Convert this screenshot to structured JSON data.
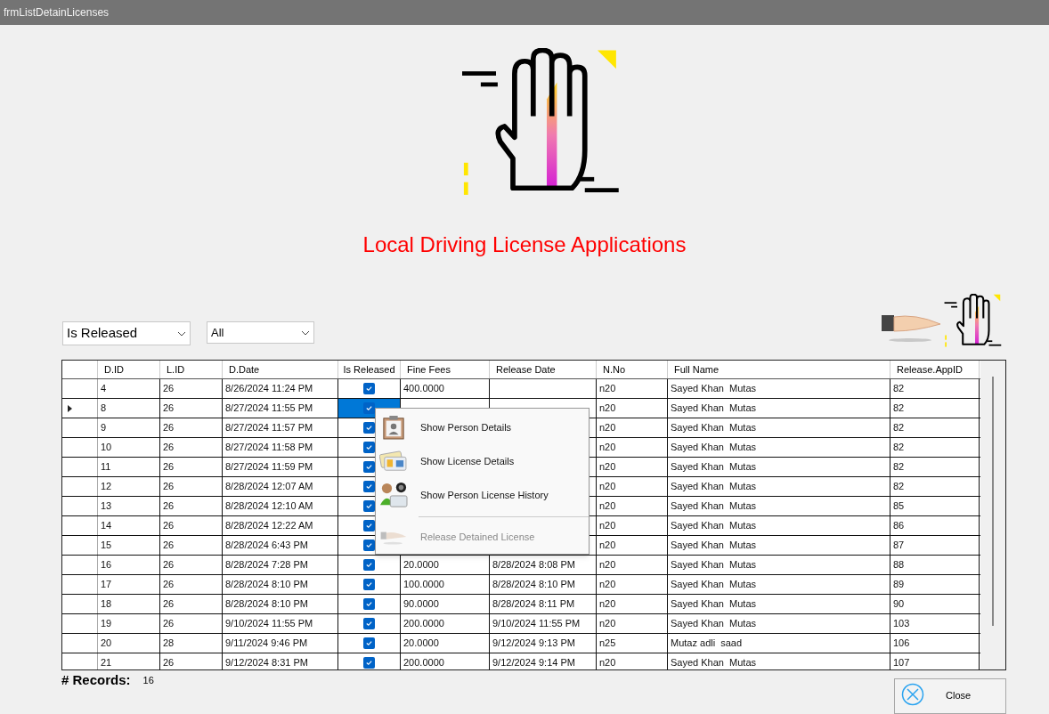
{
  "window": {
    "title": "frmListDetainLicenses"
  },
  "heading": "Local Driving License Applications",
  "filters": [
    {
      "value": "Is Released"
    },
    {
      "value": "All"
    }
  ],
  "table": {
    "columns": [
      "D.ID",
      "L.ID",
      "D.Date",
      "Is Released",
      "Fine Fees",
      "Release Date",
      "N.No",
      "Full Name",
      "Release.AppID"
    ],
    "rows": [
      {
        "selected": false,
        "d_id": "4",
        "l_id": "26",
        "d_date": "8/26/2024 11:24 PM",
        "is_released": true,
        "fine_fees": "400.0000",
        "n_no": "n20",
        "full_name": "Sayed Khan  Mutas",
        "release_app_id": "82"
      },
      {
        "selected": true,
        "d_id": "8",
        "l_id": "26",
        "d_date": "8/27/2024 11:55 PM",
        "is_released": true,
        "n_no": "n20",
        "full_name": "Sayed Khan  Mutas",
        "release_app_id": "82"
      },
      {
        "selected": false,
        "d_id": "9",
        "l_id": "26",
        "d_date": "8/27/2024 11:57 PM",
        "is_released": true,
        "n_no": "n20",
        "full_name": "Sayed Khan  Mutas",
        "release_app_id": "82"
      },
      {
        "selected": false,
        "d_id": "10",
        "l_id": "26",
        "d_date": "8/27/2024 11:58 PM",
        "is_released": true,
        "n_no": "n20",
        "full_name": "Sayed Khan  Mutas",
        "release_app_id": "82"
      },
      {
        "selected": false,
        "d_id": "11",
        "l_id": "26",
        "d_date": "8/27/2024 11:59 PM",
        "is_released": true,
        "n_no": "n20",
        "full_name": "Sayed Khan  Mutas",
        "release_app_id": "82"
      },
      {
        "selected": false,
        "d_id": "12",
        "l_id": "26",
        "d_date": "8/28/2024 12:07 AM",
        "is_released": true,
        "n_no": "n20",
        "full_name": "Sayed Khan  Mutas",
        "release_app_id": "82"
      },
      {
        "selected": false,
        "d_id": "13",
        "l_id": "26",
        "d_date": "8/28/2024 12:10 AM",
        "is_released": true,
        "n_no": "n20",
        "full_name": "Sayed Khan  Mutas",
        "release_app_id": "85"
      },
      {
        "selected": false,
        "d_id": "14",
        "l_id": "26",
        "d_date": "8/28/2024 12:22 AM",
        "is_released": true,
        "n_no": "n20",
        "full_name": "Sayed Khan  Mutas",
        "release_app_id": "86"
      },
      {
        "selected": false,
        "d_id": "15",
        "l_id": "26",
        "d_date": "8/28/2024 6:43 PM",
        "is_released": true,
        "n_no": "n20",
        "full_name": "Sayed Khan  Mutas",
        "release_app_id": "87"
      },
      {
        "selected": false,
        "d_id": "16",
        "l_id": "26",
        "d_date": "8/28/2024 7:28 PM",
        "is_released": true,
        "fine_fees": "20.0000",
        "release_date": "8/28/2024 8:08 PM",
        "n_no": "n20",
        "full_name": "Sayed Khan  Mutas",
        "release_app_id": "88"
      },
      {
        "selected": false,
        "d_id": "17",
        "l_id": "26",
        "d_date": "8/28/2024 8:10 PM",
        "is_released": true,
        "fine_fees": "100.0000",
        "release_date": "8/28/2024 8:10 PM",
        "n_no": "n20",
        "full_name": "Sayed Khan  Mutas",
        "release_app_id": "89"
      },
      {
        "selected": false,
        "d_id": "18",
        "l_id": "26",
        "d_date": "8/28/2024 8:10 PM",
        "is_released": true,
        "fine_fees": "90.0000",
        "release_date": "8/28/2024 8:11 PM",
        "n_no": "n20",
        "full_name": "Sayed Khan  Mutas",
        "release_app_id": "90"
      },
      {
        "selected": false,
        "d_id": "19",
        "l_id": "26",
        "d_date": "9/10/2024 11:55 PM",
        "is_released": true,
        "fine_fees": "200.0000",
        "release_date": "9/10/2024 11:55 PM",
        "n_no": "n20",
        "full_name": "Sayed Khan  Mutas",
        "release_app_id": "103"
      },
      {
        "selected": false,
        "d_id": "20",
        "l_id": "28",
        "d_date": "9/11/2024 9:46 PM",
        "is_released": true,
        "fine_fees": "20.0000",
        "release_date": "9/12/2024 9:13 PM",
        "n_no": "n25",
        "full_name": "Mutaz adli  saad",
        "release_app_id": "106"
      },
      {
        "selected": false,
        "d_id": "21",
        "l_id": "26",
        "d_date": "9/12/2024 8:31 PM",
        "is_released": true,
        "fine_fees": "200.0000",
        "release_date": "9/12/2024 9:14 PM",
        "n_no": "n20",
        "full_name": "Sayed Khan  Mutas",
        "release_app_id": "107"
      }
    ]
  },
  "context_menu": {
    "items": [
      {
        "kind": "item",
        "label": "Show Person Details",
        "disabled": false
      },
      {
        "kind": "item",
        "label": "Show License Details",
        "disabled": false
      },
      {
        "kind": "item",
        "label": "Show Person License History",
        "disabled": false
      },
      {
        "kind": "separator"
      },
      {
        "kind": "item",
        "label": "Release Detained License",
        "disabled": true
      }
    ]
  },
  "records": {
    "label": "# Records:",
    "value": "16"
  },
  "close_button": {
    "label": "Close"
  }
}
